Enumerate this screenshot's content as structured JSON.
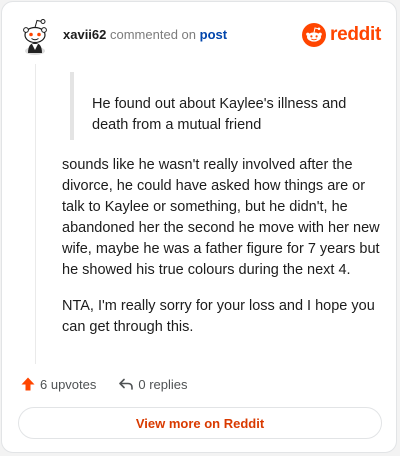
{
  "header": {
    "username": "xavii62",
    "action_text": "commented on",
    "post_link": "post",
    "brand_name": "reddit",
    "brand_color": "#ff4500"
  },
  "quote": {
    "text": "He found out about Kaylee's illness and death from a mutual friend"
  },
  "comment": {
    "paragraphs": [
      "sounds like he wasn't really involved after the divorce, he could have asked how things are or talk to Kaylee or something, but he didn't, he abandoned her the second he move with her new wife, maybe he was a father figure for 7 years but he showed his true colours during the next 4.",
      "NTA, I'm really sorry for your loss and I hope you can get through this."
    ]
  },
  "actions": {
    "upvotes_label": "6 upvotes",
    "replies_label": "0 replies",
    "upvote_icon": "upvote-arrow-icon",
    "reply_icon": "reply-arrow-icon"
  },
  "footer": {
    "view_button_label": "View more on Reddit"
  }
}
